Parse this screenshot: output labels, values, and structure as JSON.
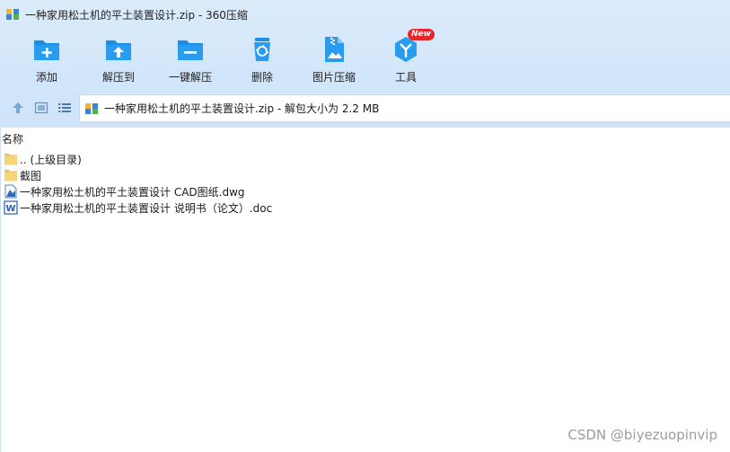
{
  "window": {
    "title": "一种家用松土机的平土装置设计.zip - 360压缩"
  },
  "toolbar": {
    "items": [
      {
        "label": "添加",
        "icon": "add-folder-icon"
      },
      {
        "label": "解压到",
        "icon": "extract-to-icon"
      },
      {
        "label": "一键解压",
        "icon": "one-click-extract-icon"
      },
      {
        "label": "删除",
        "icon": "trash-icon"
      },
      {
        "label": "图片压缩",
        "icon": "image-compress-icon"
      },
      {
        "label": "工具",
        "icon": "tools-icon",
        "badge": "New"
      }
    ]
  },
  "address": {
    "text": "一种家用松土机的平土装置设计.zip - 解包大小为 2.2 MB"
  },
  "list": {
    "column_name": "名称",
    "rows": [
      {
        "name": ".. (上级目录)",
        "icon": "folder-icon"
      },
      {
        "name": "截图",
        "icon": "folder-icon"
      },
      {
        "name": "一种家用松土机的平土装置设计 CAD图纸.dwg",
        "icon": "dwg-file-icon"
      },
      {
        "name": "一种家用松土机的平土装置设计 说明书（论文）.doc",
        "icon": "word-doc-icon"
      }
    ]
  },
  "watermark": "CSDN @biyezuopinvip",
  "colors": {
    "accent": "#1a8fe3",
    "badge": "#e6262c",
    "folder": "#f5d47a"
  }
}
